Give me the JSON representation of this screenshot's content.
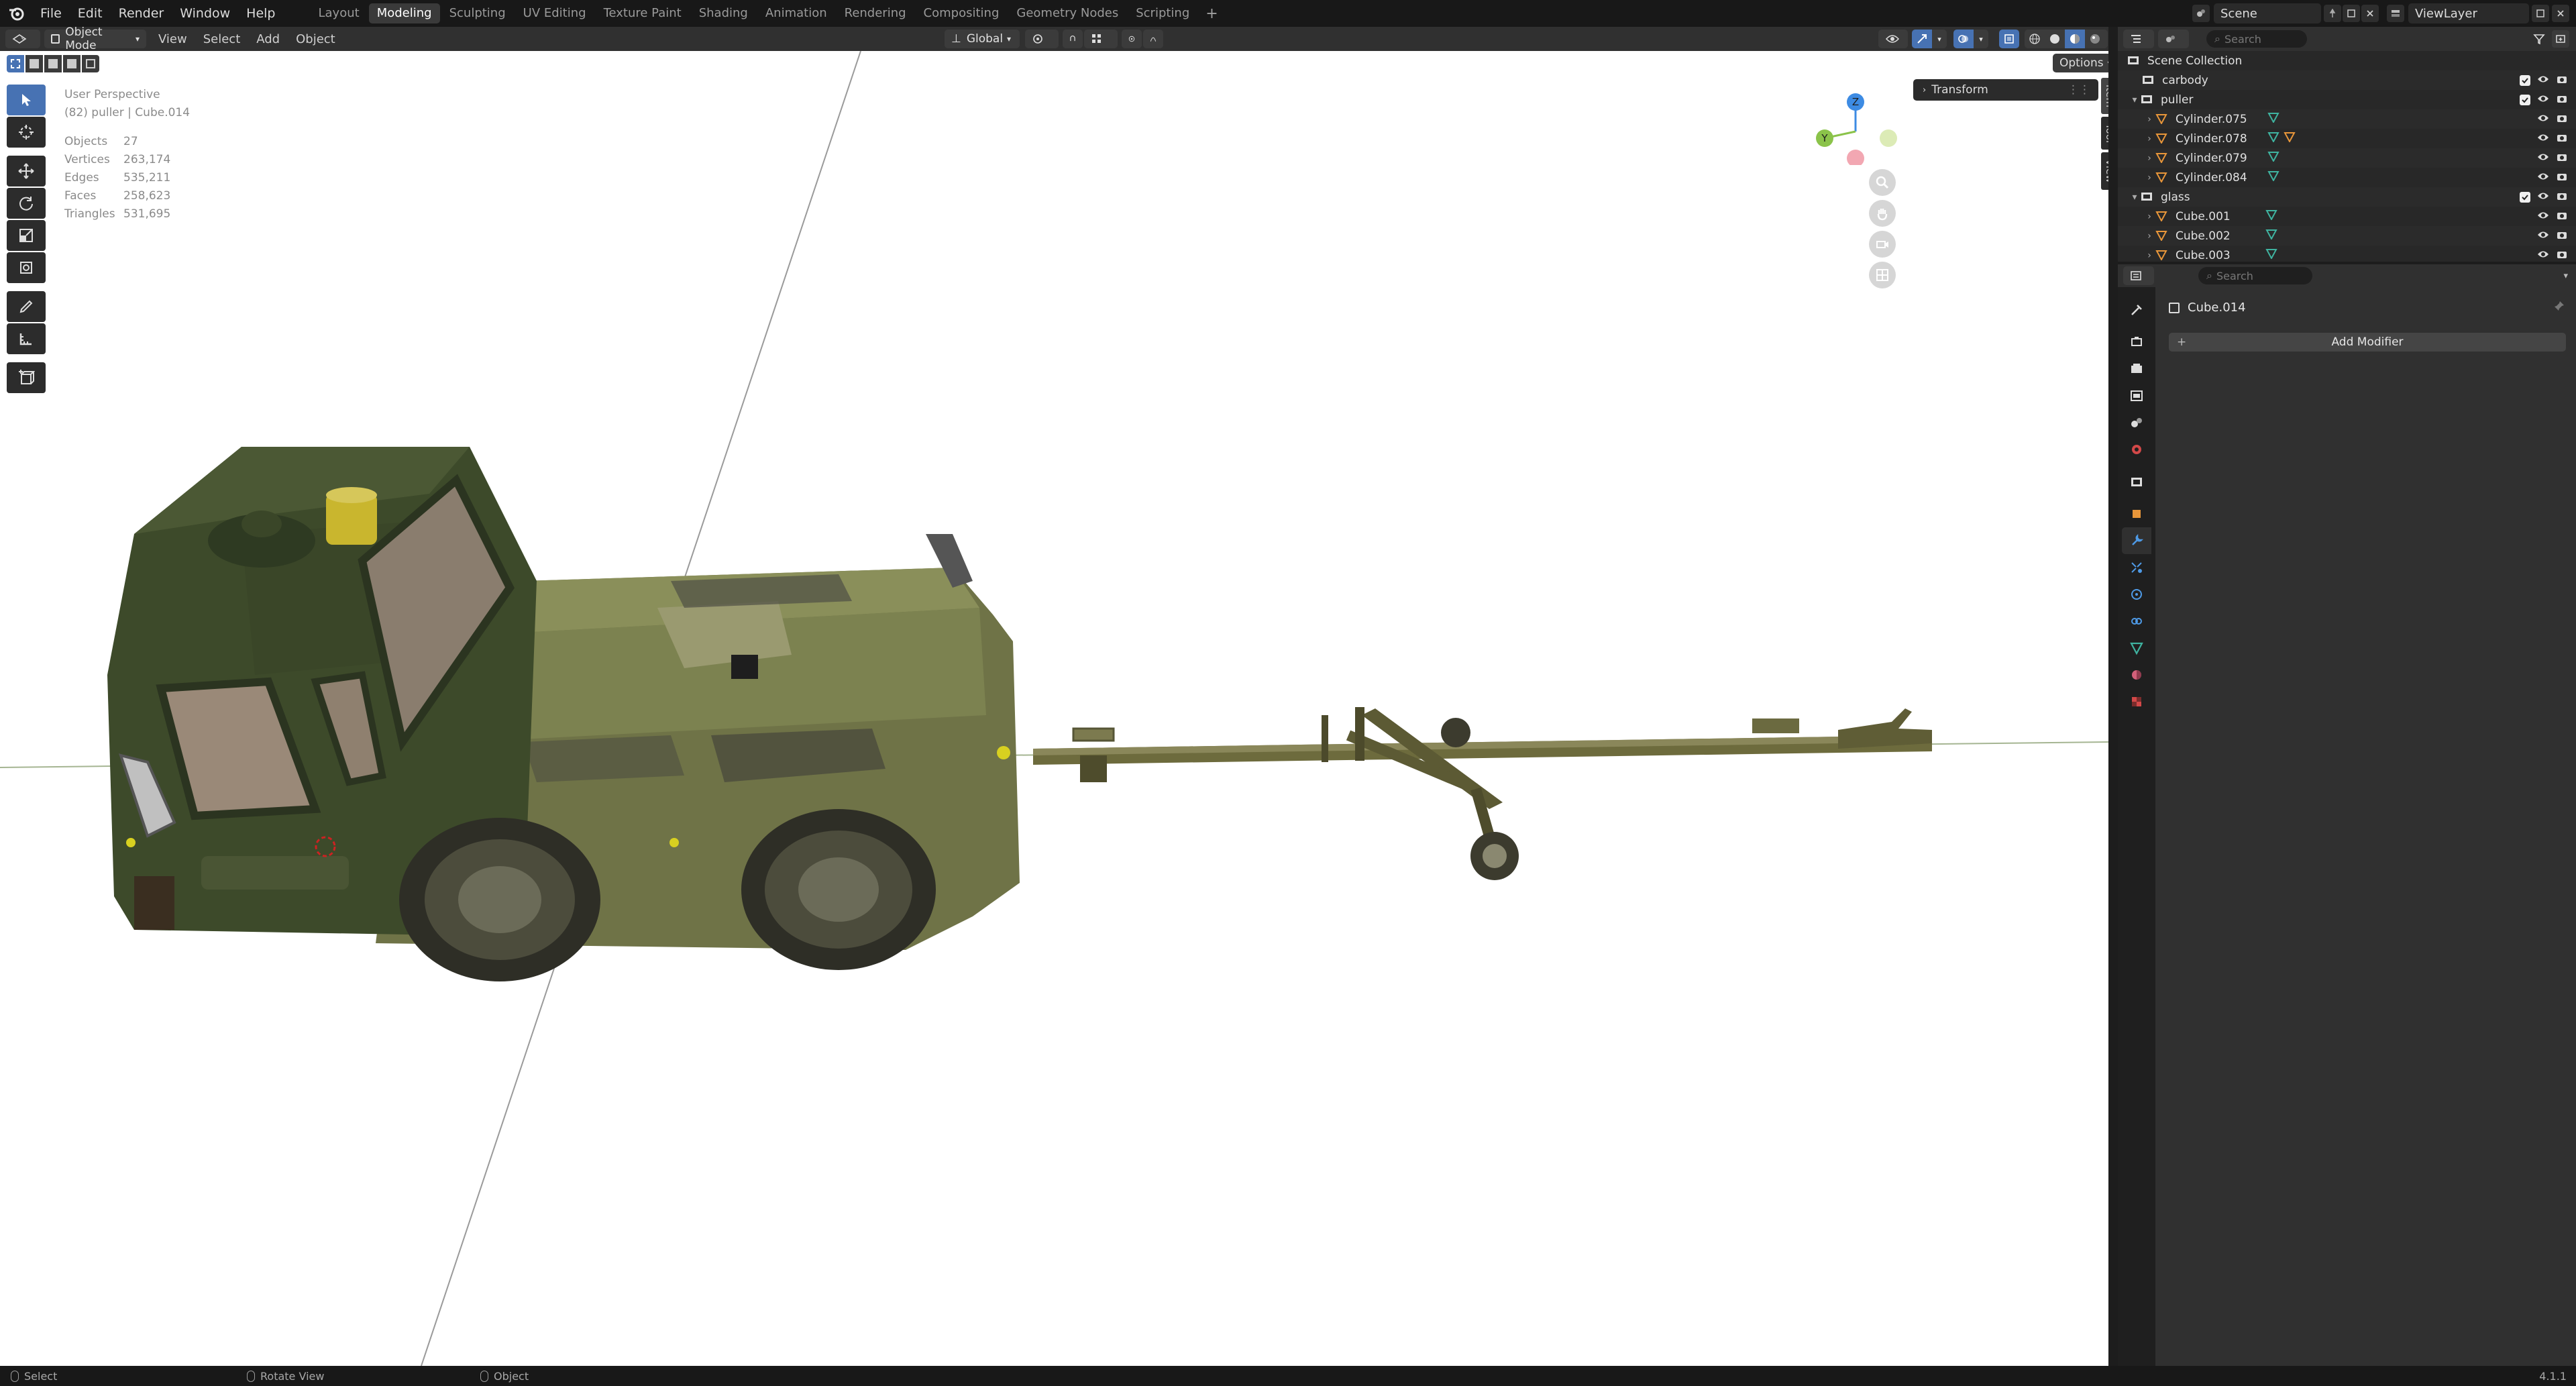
{
  "menu": {
    "items": [
      "File",
      "Edit",
      "Render",
      "Window",
      "Help"
    ]
  },
  "workspaces": {
    "tabs": [
      "Layout",
      "Modeling",
      "Sculpting",
      "UV Editing",
      "Texture Paint",
      "Shading",
      "Animation",
      "Rendering",
      "Compositing",
      "Geometry Nodes",
      "Scripting"
    ],
    "active": "Modeling"
  },
  "scene": {
    "name": "Scene",
    "view_layer": "ViewLayer"
  },
  "viewport_header": {
    "mode": "Object Mode",
    "menus": [
      "View",
      "Select",
      "Add",
      "Object"
    ],
    "orientation": "Global",
    "options": "Options"
  },
  "viewport_info": {
    "title": "User Perspective",
    "context": "(82) puller | Cube.014",
    "stats": [
      {
        "label": "Objects",
        "value": "27"
      },
      {
        "label": "Vertices",
        "value": "263,174"
      },
      {
        "label": "Edges",
        "value": "535,211"
      },
      {
        "label": "Faces",
        "value": "258,623"
      },
      {
        "label": "Triangles",
        "value": "531,695"
      }
    ]
  },
  "n_panel": {
    "transform": "Transform",
    "tabs": [
      "Item",
      "Tool",
      "View"
    ]
  },
  "gizmo": {
    "x": "X",
    "y": "Y",
    "z": "Z"
  },
  "outliner": {
    "search_placeholder": "Search",
    "root": "Scene Collection",
    "rows": [
      {
        "name": "carbody",
        "kind": "collection",
        "depth": 1
      },
      {
        "name": "puller",
        "kind": "collection",
        "depth": 1,
        "expanded": true
      },
      {
        "name": "Cylinder.075",
        "kind": "mesh",
        "depth": 2
      },
      {
        "name": "Cylinder.078",
        "kind": "mesh",
        "depth": 2
      },
      {
        "name": "Cylinder.079",
        "kind": "mesh",
        "depth": 2
      },
      {
        "name": "Cylinder.084",
        "kind": "mesh",
        "depth": 2
      },
      {
        "name": "glass",
        "kind": "collection",
        "depth": 1,
        "expanded": true
      },
      {
        "name": "Cube.001",
        "kind": "mesh",
        "depth": 2
      },
      {
        "name": "Cube.002",
        "kind": "mesh",
        "depth": 2
      },
      {
        "name": "Cube.003",
        "kind": "mesh",
        "depth": 2
      }
    ]
  },
  "properties": {
    "search_placeholder": "Search",
    "object_name": "Cube.014",
    "add_modifier": "Add Modifier"
  },
  "status_bar": {
    "select": "Select",
    "rotate": "Rotate View",
    "object": "Object",
    "version": "4.1.1"
  },
  "colors": {
    "accent": "#4772b3",
    "axis_x": "#e8556a",
    "axis_y": "#8bc34a",
    "axis_z": "#3d8be3",
    "mesh_icon": "#e8963a",
    "vgroup_icon": "#3fb3a0"
  }
}
